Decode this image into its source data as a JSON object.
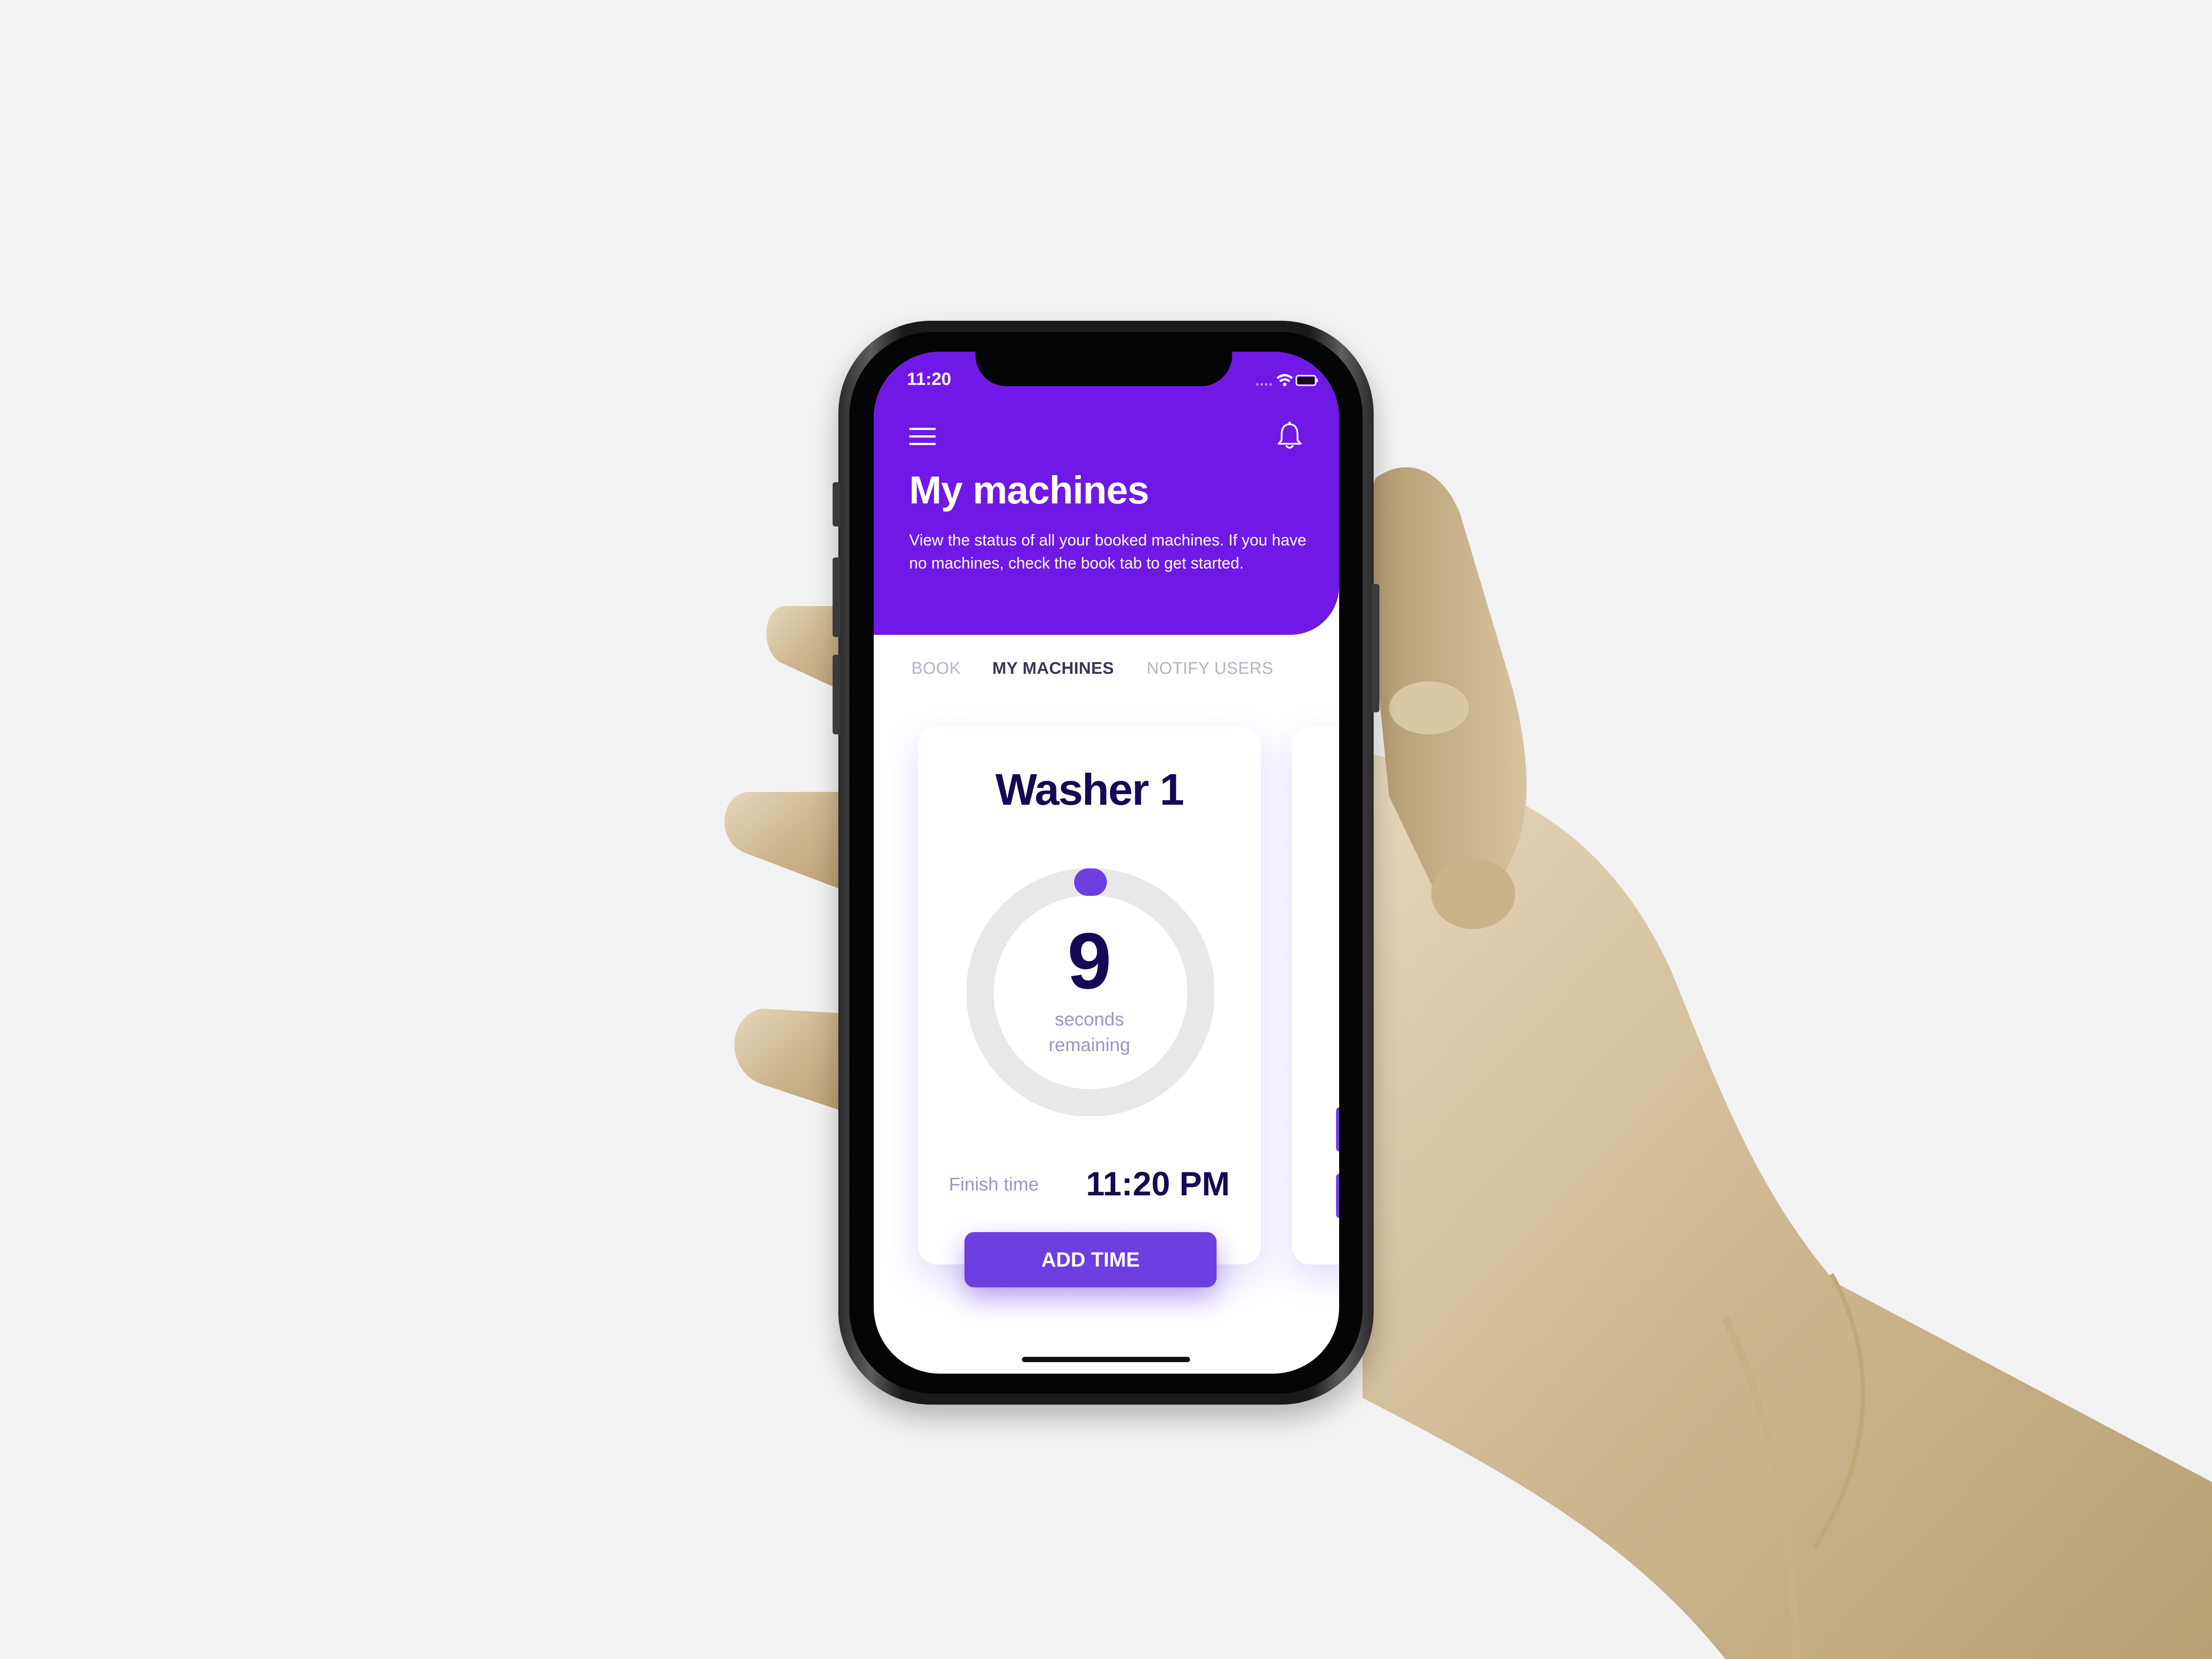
{
  "status_bar": {
    "time": "11:20"
  },
  "header": {
    "menu_icon": "menu-icon",
    "notification_icon": "bell-icon",
    "title": "My machines",
    "subtitle": "View the status of all your booked machines. If you have no machines, check the book tab to get started."
  },
  "tabs": [
    {
      "label": "BOOK",
      "active": false
    },
    {
      "label": "MY MACHINES",
      "active": true
    },
    {
      "label": "NOTIFY USERS",
      "active": false
    }
  ],
  "machine_card": {
    "name": "Washer 1",
    "countdown_value": "9",
    "countdown_unit": "seconds remaining",
    "finish_label": "Finish time",
    "finish_time": "11:20 PM",
    "add_time_label": "ADD TIME"
  },
  "colors": {
    "brand_purple": "#7019e6",
    "button_purple": "#6d3fe0",
    "title_navy": "#140a55",
    "muted_lavender": "#9a95c4",
    "ring_gray": "#e8e8e8",
    "background": "#f2f2f2"
  }
}
